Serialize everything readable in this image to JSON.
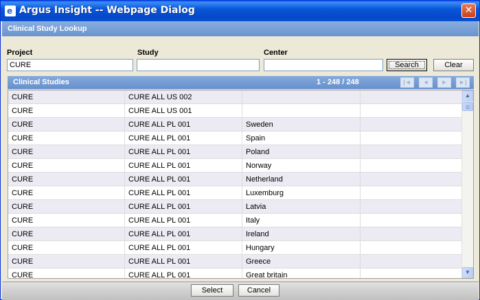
{
  "window": {
    "title": "Argus Insight -- Webpage Dialog",
    "close_glyph": "✕",
    "app_icon_glyph": "e"
  },
  "section": {
    "title": "Clinical Study Lookup"
  },
  "form": {
    "project_label": "Project",
    "project_value": "CURE",
    "study_label": "Study",
    "study_value": "",
    "center_label": "Center",
    "center_value": "",
    "search_label": "Search",
    "clear_label": "Clear"
  },
  "grid": {
    "title": "Clinical Studies",
    "count": "1 - 248 / 248",
    "nav": {
      "first": "|◄",
      "prev": "◄",
      "next": "►",
      "last": "►|"
    },
    "rows": [
      [
        "CURE",
        "CURE ALL US 002",
        "",
        ""
      ],
      [
        "CURE",
        "CURE ALL US 001",
        "",
        ""
      ],
      [
        "CURE",
        "CURE ALL PL 001",
        "Sweden",
        ""
      ],
      [
        "CURE",
        "CURE ALL PL 001",
        "Spain",
        ""
      ],
      [
        "CURE",
        "CURE ALL PL 001",
        "Poland",
        ""
      ],
      [
        "CURE",
        "CURE ALL PL 001",
        "Norway",
        ""
      ],
      [
        "CURE",
        "CURE ALL PL 001",
        "Netherland",
        ""
      ],
      [
        "CURE",
        "CURE ALL PL 001",
        "Luxemburg",
        ""
      ],
      [
        "CURE",
        "CURE ALL PL 001",
        "Latvia",
        ""
      ],
      [
        "CURE",
        "CURE ALL PL 001",
        "Italy",
        ""
      ],
      [
        "CURE",
        "CURE ALL PL 001",
        "Ireland",
        ""
      ],
      [
        "CURE",
        "CURE ALL PL 001",
        "Hungary",
        ""
      ],
      [
        "CURE",
        "CURE ALL PL 001",
        "Greece",
        ""
      ],
      [
        "CURE",
        "CURE ALL PL 001",
        "Great britain",
        ""
      ]
    ],
    "scroll_up_glyph": "▲",
    "scroll_down_glyph": "▼"
  },
  "footer": {
    "select_label": "Select",
    "cancel_label": "Cancel"
  },
  "colors": {
    "titlebar": "#0a57d8",
    "section_header": "#7aa2d8",
    "row_alt": "#eceaf2"
  }
}
